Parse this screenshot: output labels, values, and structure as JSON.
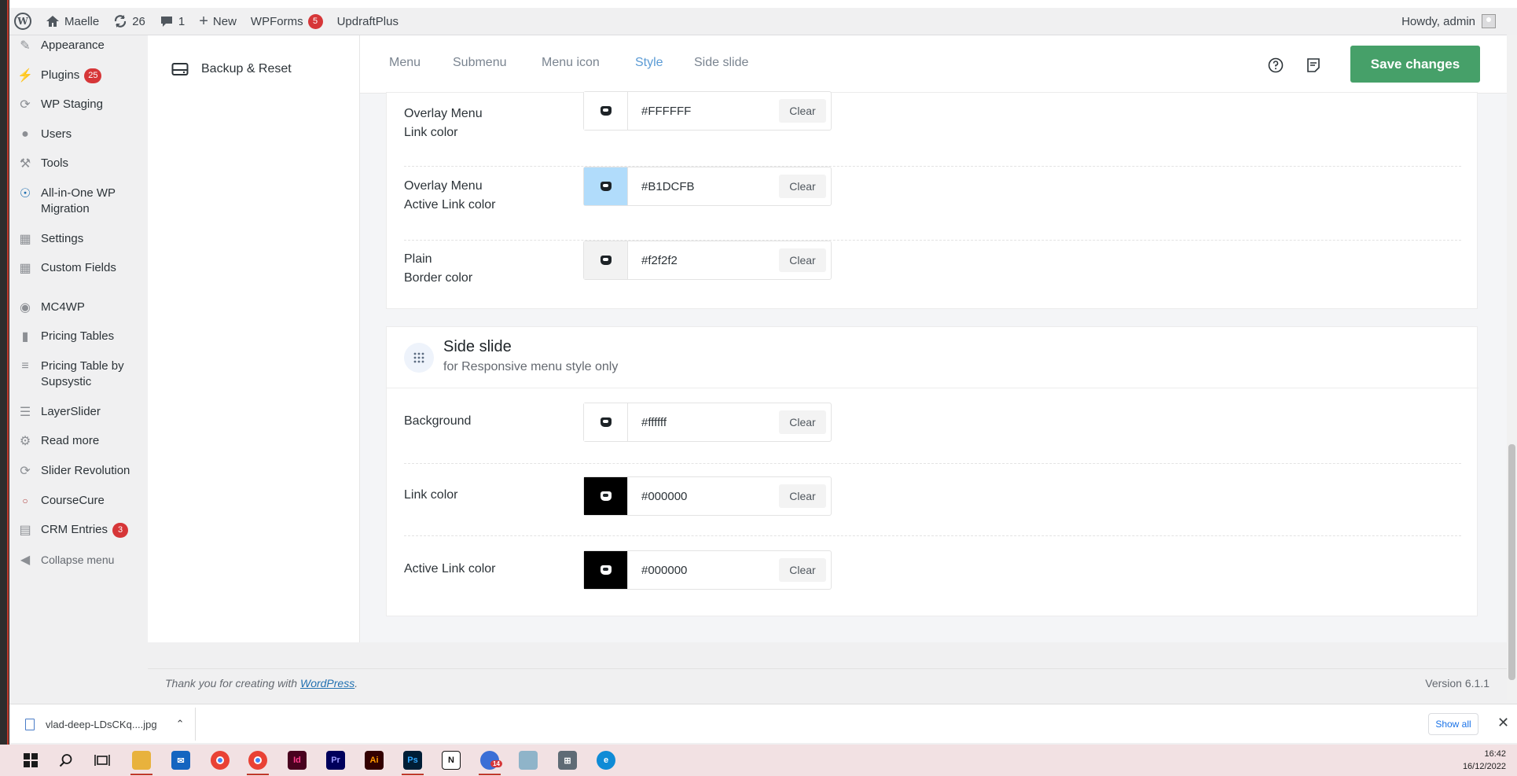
{
  "adminbar": {
    "site_name": "Maelle",
    "updates_count": "26",
    "comments_count": "1",
    "new_label": "New",
    "wpforms_label": "WPForms",
    "wpforms_badge": "5",
    "updraft_label": "UpdraftPlus",
    "howdy": "Howdy, admin"
  },
  "menu": {
    "items": [
      {
        "label": "Appearance",
        "icon": "paintbrush-icon"
      },
      {
        "label": "Plugins",
        "badge": "25",
        "icon": "plug-icon"
      },
      {
        "label": "WP Staging",
        "icon": "sync-icon"
      },
      {
        "label": "Users",
        "icon": "user-icon"
      },
      {
        "label": "Tools",
        "icon": "wrench-icon"
      },
      {
        "label": "All-in-One WP",
        "label2": "Migration",
        "icon": "migration-icon"
      },
      {
        "label": "Settings",
        "icon": "settings-icon"
      },
      {
        "label": "Custom Fields",
        "icon": "table-icon"
      },
      {
        "label": "MC4WP",
        "icon": "mc4wp-icon"
      },
      {
        "label": "Pricing Tables",
        "icon": "bars-icon"
      },
      {
        "label": "Pricing Table by",
        "label2": "Supsystic",
        "icon": "stack-icon"
      },
      {
        "label": "LayerSlider",
        "icon": "layers-icon"
      },
      {
        "label": "Read more",
        "icon": "gear-icon"
      },
      {
        "label": "Slider Revolution",
        "icon": "revolution-icon"
      },
      {
        "label": "CourseCure",
        "icon": "course-icon"
      },
      {
        "label": "CRM Entries",
        "badge": "3",
        "icon": "crm-icon"
      },
      {
        "label": "Collapse menu",
        "icon": "collapse-icon"
      }
    ]
  },
  "settings_nav": {
    "backup_label": "Backup & Reset"
  },
  "tabs": {
    "menu": "Menu",
    "submenu": "Submenu",
    "menu_icon": "Menu icon",
    "style": "Style",
    "side_slide": "Side slide"
  },
  "save_label": "Save changes",
  "overlay_section": {
    "rows": [
      {
        "label_line1": "Overlay Menu",
        "label_line2": "Link color",
        "value": "#FFFFFF",
        "swatch": "#FFFFFF",
        "clear": "Clear"
      },
      {
        "label_line1": "Overlay Menu",
        "label_line2": "Active Link color",
        "value": "#B1DCFB",
        "swatch": "#B1DCFB",
        "clear": "Clear"
      },
      {
        "label_line1": "Plain",
        "label_line2": "Border color",
        "value": "#f2f2f2",
        "swatch": "#f2f2f2",
        "clear": "Clear"
      }
    ]
  },
  "side_slide_section": {
    "title": "Side slide",
    "subtitle": "for Responsive menu style only",
    "rows": [
      {
        "label": "Background",
        "value": "#ffffff",
        "swatch": "#ffffff",
        "clear": "Clear"
      },
      {
        "label": "Link color",
        "value": "#000000",
        "swatch": "#000000",
        "clear": "Clear"
      },
      {
        "label": "Active Link color",
        "value": "#000000",
        "swatch": "#000000",
        "clear": "Clear"
      }
    ]
  },
  "footer": {
    "thanks_prefix": "Thank you for creating with ",
    "wordpress_link": "WordPress",
    "thanks_suffix": ".",
    "version": "Version 6.1.1"
  },
  "downloads": {
    "filename": "vlad-deep-LDsCKq....jpg",
    "show_all": "Show all"
  },
  "taskbar": {
    "time": "16:42",
    "date": "16/12/2022",
    "mail_badge": "14"
  }
}
